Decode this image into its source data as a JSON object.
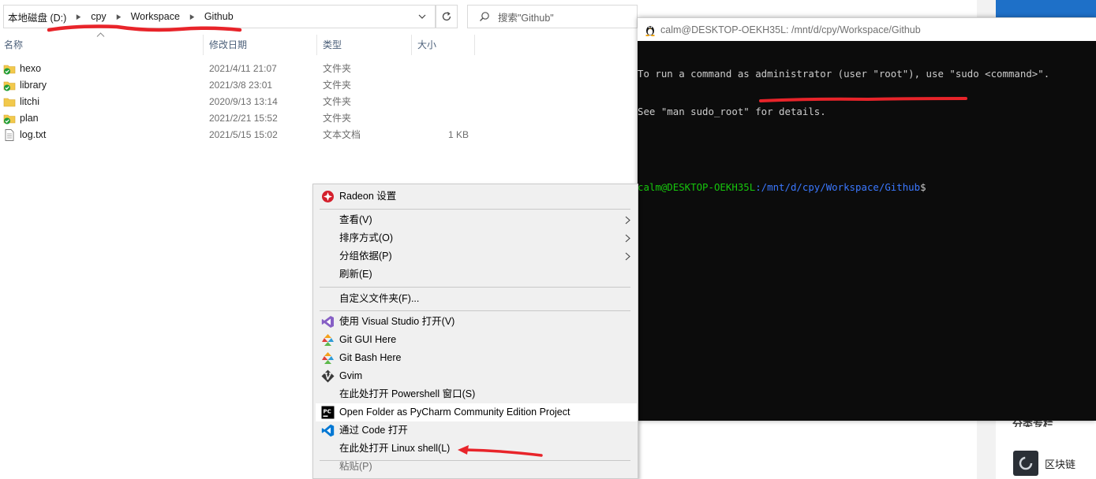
{
  "explorer": {
    "breadcrumbs": [
      "本地磁盘 (D:)",
      "cpy",
      "Workspace",
      "Github"
    ],
    "search_placeholder": "搜索\"Github\"",
    "columns": [
      "名称",
      "修改日期",
      "类型",
      "大小"
    ],
    "rows": [
      {
        "name": "hexo",
        "date": "2021/4/11 21:07",
        "type": "文件夹",
        "size": "",
        "icon": "folder-synced-icon"
      },
      {
        "name": "library",
        "date": "2021/3/8 23:01",
        "type": "文件夹",
        "size": "",
        "icon": "folder-synced-icon"
      },
      {
        "name": "litchi",
        "date": "2020/9/13 13:14",
        "type": "文件夹",
        "size": "",
        "icon": "folder-icon"
      },
      {
        "name": "plan",
        "date": "2021/2/21 15:52",
        "type": "文件夹",
        "size": "",
        "icon": "folder-synced-icon"
      },
      {
        "name": "log.txt",
        "date": "2021/5/15 15:02",
        "type": "文本文档",
        "size": "1 KB",
        "icon": "text-file-icon"
      }
    ]
  },
  "terminal": {
    "title": "calm@DESKTOP-OEKH35L: /mnt/d/cpy/Workspace/Github",
    "lines": [
      "To run a command as administrator (user \"root\"), use \"sudo <command>\".",
      "See \"man sudo_root\" for details."
    ],
    "prompt_user": "calm@DESKTOP-OEKH35L",
    "prompt_path": ":/mnt/d/cpy/Workspace/Github",
    "prompt_symbol": "$"
  },
  "context_menu": {
    "items": [
      {
        "label": "Radeon 设置",
        "icon": "radeon-icon"
      },
      {
        "label": "查看(V)",
        "submenu": true
      },
      {
        "label": "排序方式(O)",
        "submenu": true
      },
      {
        "label": "分组依据(P)",
        "submenu": true
      },
      {
        "label": "刷新(E)"
      },
      {
        "label": "自定义文件夹(F)..."
      },
      {
        "label": "使用 Visual Studio 打开(V)",
        "icon": "visual-studio-icon"
      },
      {
        "label": "Git GUI Here",
        "icon": "git-gui-icon"
      },
      {
        "label": "Git Bash Here",
        "icon": "git-bash-icon"
      },
      {
        "label": "Gvim",
        "icon": "gvim-icon"
      },
      {
        "label": "在此处打开 Powershell 窗口(S)"
      },
      {
        "label": "Open Folder as PyCharm Community Edition Project",
        "icon": "pycharm-icon"
      },
      {
        "label": "通过 Code 打开",
        "icon": "vscode-icon"
      },
      {
        "label": "在此处打开 Linux shell(L)"
      },
      {
        "label": "粘贴(P)",
        "disabled": true
      }
    ]
  },
  "background_window": {
    "heading": "分类专栏",
    "item": "区块链"
  },
  "colors": {
    "annotation_red": "#e8242a",
    "prompt_green": "#16c60c",
    "prompt_blue": "#3b78ff"
  }
}
